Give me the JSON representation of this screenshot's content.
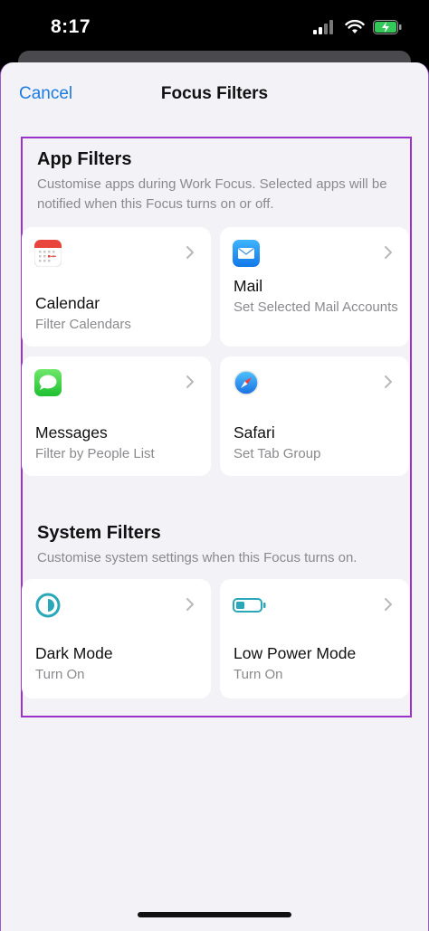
{
  "status": {
    "time": "8:17"
  },
  "nav": {
    "cancel": "Cancel",
    "title": "Focus Filters"
  },
  "app_filters": {
    "title": "App Filters",
    "description": "Customise apps during Work Focus. Selected apps will be notified when this Focus turns on or off.",
    "items": [
      {
        "name": "Calendar",
        "subtitle": "Filter Calendars",
        "icon": "calendar-icon"
      },
      {
        "name": "Mail",
        "subtitle": "Set Selected Mail Accounts",
        "icon": "mail-icon"
      },
      {
        "name": "Messages",
        "subtitle": "Filter by People List",
        "icon": "messages-icon"
      },
      {
        "name": "Safari",
        "subtitle": "Set Tab Group",
        "icon": "safari-icon"
      }
    ]
  },
  "system_filters": {
    "title": "System Filters",
    "description": "Customise system settings when this Focus turns on.",
    "items": [
      {
        "name": "Dark Mode",
        "subtitle": "Turn On",
        "icon": "dark-mode-icon"
      },
      {
        "name": "Low Power Mode",
        "subtitle": "Turn On",
        "icon": "battery-icon"
      }
    ]
  },
  "colors": {
    "accent": "#1a7be0",
    "highlight": "#9b33c9",
    "background": "#f2f2f7"
  }
}
